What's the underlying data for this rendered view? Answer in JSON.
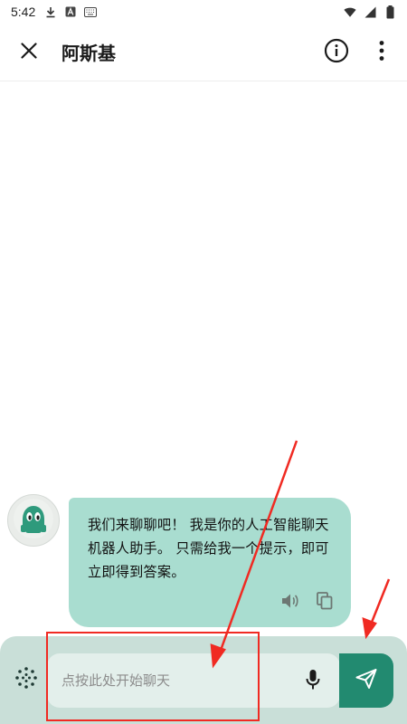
{
  "status_bar": {
    "time": "5:42",
    "left_icons": [
      "download-icon",
      "a-badge-icon",
      "keyboard-icon"
    ],
    "right_icons": [
      "wifi-icon",
      "signal-icon",
      "battery-icon"
    ]
  },
  "app_bar": {
    "title": "阿斯基",
    "close_icon": "close-icon",
    "info_icon": "info-icon",
    "more_icon": "more-vert-icon"
  },
  "chat": {
    "messages": [
      {
        "sender": "bot",
        "avatar_icon": "robot-avatar-icon",
        "text_lines": [
          "我们来聊聊吧！ 我是你的人工智能聊天",
          "机器人助手。 只需给我一个提示，即可",
          "立即得到答案。"
        ],
        "actions": [
          "speaker-icon",
          "copy-icon"
        ]
      }
    ]
  },
  "input_bar": {
    "placeholder": "点按此处开始聊天",
    "value": "",
    "left_icon": "sparkle-icon",
    "mic_icon": "microphone-icon",
    "send_icon": "send-icon"
  },
  "colors": {
    "bubble": "#a9ddd0",
    "input_bar_bg": "#c9dfd8",
    "input_field_bg": "#e3efeb",
    "send_button": "#228a70",
    "annotation": "#f02a22"
  }
}
